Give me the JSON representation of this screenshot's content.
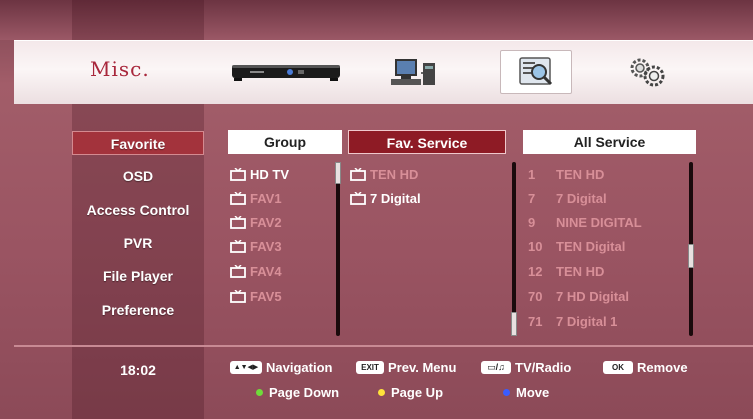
{
  "header": {
    "title": "Misc.",
    "tabs": [
      {
        "name": "receiver-icon"
      },
      {
        "name": "network-icon"
      },
      {
        "name": "system-info-icon"
      },
      {
        "name": "settings-gear-icon"
      }
    ]
  },
  "menu": {
    "items": [
      "Favorite",
      "OSD",
      "Access Control",
      "PVR",
      "File Player",
      "Preference"
    ],
    "selected": "Favorite"
  },
  "columns": {
    "group": {
      "header": "Group",
      "items": [
        "HD TV",
        "FAV1",
        "FAV2",
        "FAV3",
        "FAV4",
        "FAV5"
      ]
    },
    "fav_service": {
      "header": "Fav. Service",
      "items": [
        "TEN HD",
        "7 Digital"
      ]
    },
    "all_service": {
      "header": "All Service",
      "items": [
        {
          "num": "1",
          "name": "TEN HD"
        },
        {
          "num": "7",
          "name": "7 Digital"
        },
        {
          "num": "9",
          "name": "NINE DIGITAL"
        },
        {
          "num": "10",
          "name": "TEN Digital"
        },
        {
          "num": "12",
          "name": "TEN HD"
        },
        {
          "num": "70",
          "name": "7 HD Digital"
        },
        {
          "num": "71",
          "name": "7 Digital 1"
        }
      ]
    }
  },
  "footer": {
    "time": "18:02",
    "hints": {
      "navigation": "Navigation",
      "prev_menu": "Prev. Menu",
      "tv_radio": "TV/Radio",
      "remove": "Remove",
      "page_down": "Page Down",
      "page_up": "Page Up",
      "move": "Move"
    },
    "keys": {
      "exit": "EXIT",
      "ok": "OK"
    },
    "colors": {
      "green": "#6fdc3a",
      "yellow": "#ffe23a",
      "blue": "#3a5cff"
    }
  }
}
